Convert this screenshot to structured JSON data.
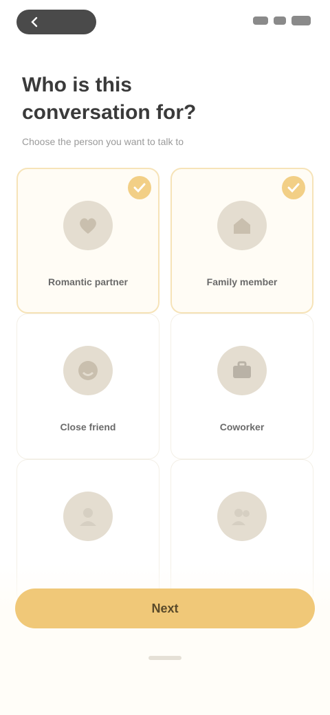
{
  "top_bar": {
    "back_label": ""
  },
  "header": {
    "title": "Who is this\nconversation for?",
    "subtitle": "Choose the person you want to talk to"
  },
  "cards": [
    {
      "label": "Romantic partner",
      "icon": "heart-icon",
      "selected": true
    },
    {
      "label": "Family member",
      "icon": "home-icon",
      "selected": true
    },
    {
      "label": "Close friend",
      "icon": "smile-icon",
      "selected": false
    },
    {
      "label": "Coworker",
      "icon": "briefcase-icon",
      "selected": false
    },
    {
      "label": "",
      "icon": "user-icon",
      "selected": false
    },
    {
      "label": "",
      "icon": "users-icon",
      "selected": false
    }
  ],
  "cta": {
    "label": "Next"
  },
  "colors": {
    "accent": "#f0c878",
    "selected_badge": "#f2cf86",
    "avatar_bg": "#e4ddd0"
  }
}
